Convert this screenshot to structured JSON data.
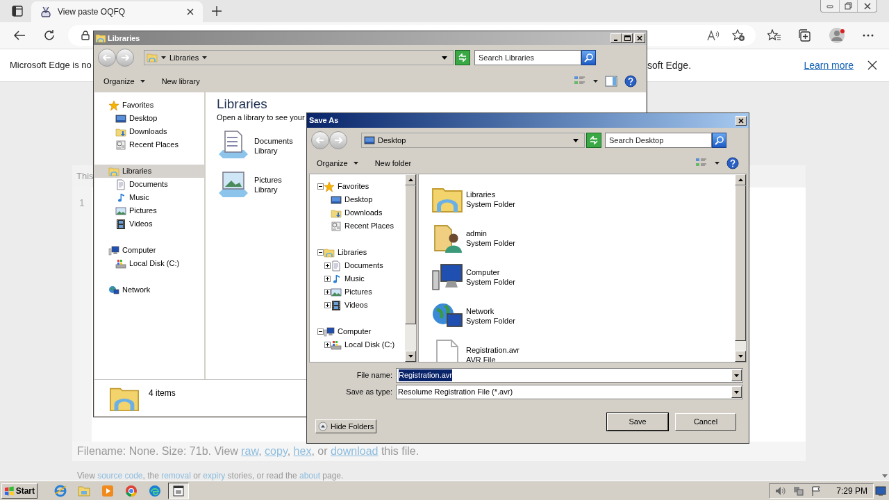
{
  "browser": {
    "tab": {
      "title": "View paste OQFQ"
    },
    "infobar": {
      "text_left": "Microsoft Edge is no",
      "text_right": "soft Edge.",
      "link": "Learn more"
    }
  },
  "page": {
    "header_text": "This",
    "line_number": "1",
    "file_info": [
      {
        "text": "Filename: None. Size: 71b. View ",
        "link": false
      },
      {
        "text": "raw",
        "link": true
      },
      {
        "text": ", ",
        "link": false
      },
      {
        "text": "copy",
        "link": true
      },
      {
        "text": ", ",
        "link": false
      },
      {
        "text": "hex",
        "link": true
      },
      {
        "text": ", or ",
        "link": false
      },
      {
        "text": "download",
        "link": true
      },
      {
        "text": " this file.",
        "link": false
      }
    ],
    "footer": [
      {
        "text": "View ",
        "link": false
      },
      {
        "text": "source code",
        "link": true
      },
      {
        "text": ", the ",
        "link": false
      },
      {
        "text": "removal",
        "link": true
      },
      {
        "text": " or ",
        "link": false
      },
      {
        "text": "expiry",
        "link": true
      },
      {
        "text": " stories, or read the ",
        "link": false
      },
      {
        "text": "about",
        "link": true
      },
      {
        "text": " page.",
        "link": false
      }
    ]
  },
  "libraries_window": {
    "title": "Libraries",
    "breadcrumb": "Libraries",
    "search": {
      "placeholder": "Search Libraries"
    },
    "toolbar": [
      {
        "label": "Organize",
        "kind": "menu"
      },
      {
        "label": "New library",
        "kind": "button"
      }
    ],
    "nav": [
      {
        "label": "Favorites",
        "selected": false,
        "children": [
          {
            "label": "Desktop",
            "selected": false
          },
          {
            "label": "Downloads",
            "selected": false
          },
          {
            "label": "Recent Places",
            "selected": false
          }
        ]
      },
      {
        "label": "Libraries",
        "selected": true,
        "children": [
          {
            "label": "Documents",
            "selected": false
          },
          {
            "label": "Music",
            "selected": false
          },
          {
            "label": "Pictures",
            "selected": false
          },
          {
            "label": "Videos",
            "selected": false
          }
        ]
      },
      {
        "label": "Computer",
        "selected": false,
        "children": [
          {
            "label": "Local Disk (C:)",
            "selected": false
          }
        ]
      },
      {
        "label": "Network",
        "selected": false
      }
    ],
    "heading": "Libraries",
    "description": "Open a library to see your",
    "items": [
      {
        "name": "Documents",
        "type": "Library"
      },
      {
        "name": "Pictures",
        "type": "Library"
      }
    ],
    "status": "4 items"
  },
  "save_as": {
    "title": "Save As",
    "location": "Desktop",
    "search": {
      "placeholder": "Search Desktop"
    },
    "toolbar": [
      {
        "label": "Organize",
        "kind": "menu"
      },
      {
        "label": "New folder",
        "kind": "button"
      }
    ],
    "tree": [
      {
        "label": "Favorites",
        "expanded": true,
        "children": [
          {
            "label": "Desktop"
          },
          {
            "label": "Downloads"
          },
          {
            "label": "Recent Places"
          }
        ]
      },
      {
        "label": "Libraries",
        "expanded": true,
        "children": [
          {
            "label": "Documents",
            "expanded": false
          },
          {
            "label": "Music",
            "expanded": false
          },
          {
            "label": "Pictures",
            "expanded": false
          },
          {
            "label": "Videos",
            "expanded": false
          }
        ]
      },
      {
        "label": "Computer",
        "expanded": true,
        "children": [
          {
            "label": "Local Disk (C:)",
            "expanded": false
          }
        ]
      }
    ],
    "files": [
      {
        "name": "Libraries",
        "type": "System Folder"
      },
      {
        "name": "admin",
        "type": "System Folder"
      },
      {
        "name": "Computer",
        "type": "System Folder"
      },
      {
        "name": "Network",
        "type": "System Folder"
      },
      {
        "name": "Registration.avr",
        "type": "AVR File"
      }
    ],
    "file_name": {
      "label": "File name:",
      "value": "Registration.avr",
      "selected": true
    },
    "save_type": {
      "label": "Save as type:",
      "value": "Resolume Registration File (*.avr)"
    },
    "hide_folders": "Hide Folders",
    "buttons": [
      {
        "label": "Save",
        "default": true
      },
      {
        "label": "Cancel",
        "default": false
      }
    ]
  },
  "taskbar": {
    "start": "Start",
    "apps": [
      {
        "selected": false
      },
      {
        "selected": false
      },
      {
        "selected": false
      },
      {
        "selected": false
      },
      {
        "selected": false
      },
      {
        "selected": true
      }
    ],
    "clock": "7:29 PM"
  }
}
